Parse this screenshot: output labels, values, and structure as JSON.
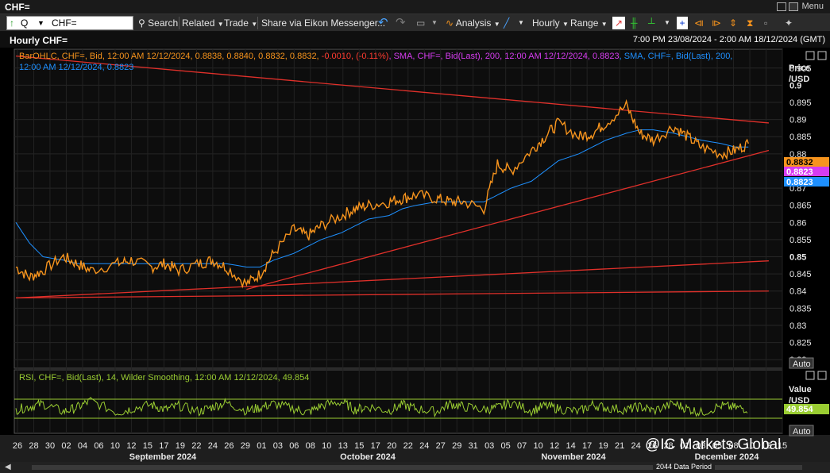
{
  "window": {
    "title": "CHF=",
    "menu_label": "Menu"
  },
  "toolbar": {
    "ric_value": "CHF=",
    "search_label": "Search",
    "related_label": "Related",
    "trade_label": "Trade",
    "share_label": "Share via Eikon Messenger...",
    "analysis_label": "Analysis",
    "interval_label": "Hourly",
    "range_label": "Range"
  },
  "chart_header": {
    "title": "Hourly CHF=",
    "range": "7:00 PM 23/08/2024 - 2:00 AM 18/12/2024 (GMT)"
  },
  "legend": {
    "l1_a": "BarOHLC, CHF=, Bid, 12:00 AM 12/12/2024, 0.8838, 0.8840, 0.8832, 0.8832, ",
    "l1_b": "-0.0010, (-0.11%)",
    "l1_c": ", SMA, CHF=, Bid(Last), 200, 12:00 AM 12/12/2024, 0.8823",
    "l1_d": ", SMA, CHF=, Bid(Last), 200,",
    "l2": "12:00 AM 12/12/2024, 0.8823"
  },
  "price_axis": {
    "title_1": "Price",
    "title_2": "/USD",
    "ticks": [
      "0.905",
      "0.9",
      "0.895",
      "0.89",
      "0.885",
      "0.88",
      "0.875",
      "0.87",
      "0.865",
      "0.86",
      "0.855",
      "0.85",
      "0.845",
      "0.84",
      "0.835",
      "0.83",
      "0.825",
      "0.82"
    ],
    "tags": [
      {
        "label": "0.8832",
        "value": 0.8832,
        "bg": "#f7941d",
        "fg": "#000000"
      },
      {
        "label": "0.8823",
        "value": 0.8823,
        "bg": "#d63cf0",
        "fg": "#ffffff"
      },
      {
        "label": "0.8823",
        "value": 0.8823,
        "bg": "#1e90ff",
        "fg": "#ffffff"
      }
    ],
    "auto_label": "Auto"
  },
  "rsi": {
    "legend": "RSI, CHF=, Bid(Last), 14, Wilder Smoothing, 12:00 AM 12/12/2024, 49.854",
    "axis_title_1": "Value",
    "axis_title_2": "/USD",
    "tag": "49.854",
    "auto_label": "Auto"
  },
  "x_axis": {
    "days": [
      "26",
      "28",
      "30",
      "02",
      "04",
      "06",
      "10",
      "12",
      "15",
      "17",
      "19",
      "22",
      "24",
      "26",
      "29",
      "01",
      "03",
      "06",
      "08",
      "10",
      "13",
      "15",
      "17",
      "20",
      "22",
      "24",
      "27",
      "29",
      "31",
      "03",
      "05",
      "07",
      "10",
      "12",
      "14",
      "17",
      "19",
      "21",
      "24",
      "26",
      "28",
      "01",
      "03",
      "05",
      "08",
      "10",
      "12",
      "15"
    ],
    "months": [
      "September 2024",
      "October 2024",
      "November 2024",
      "December 2024"
    ]
  },
  "watermark": "@IC Markets Global",
  "footer": {
    "period": "2044 Data Period"
  },
  "colors": {
    "price": "#f7941d",
    "sma": "#1e90ff",
    "trend": "#e0302a",
    "rsi": "#9acd32",
    "grid": "#2e2e2e"
  },
  "chart_data": {
    "type": "line",
    "title": "Hourly CHF=",
    "ylabel": "Price /USD",
    "ylim": [
      0.8175,
      0.9105
    ],
    "x": [
      "2024-08-26",
      "2024-08-28",
      "2024-08-30",
      "2024-09-02",
      "2024-09-04",
      "2024-09-06",
      "2024-09-10",
      "2024-09-12",
      "2024-09-15",
      "2024-09-17",
      "2024-09-19",
      "2024-09-22",
      "2024-09-24",
      "2024-09-26",
      "2024-09-29",
      "2024-10-01",
      "2024-10-03",
      "2024-10-06",
      "2024-10-08",
      "2024-10-10",
      "2024-10-13",
      "2024-10-15",
      "2024-10-17",
      "2024-10-20",
      "2024-10-22",
      "2024-10-24",
      "2024-10-27",
      "2024-10-29",
      "2024-10-31",
      "2024-11-03",
      "2024-11-05",
      "2024-11-07",
      "2024-11-10",
      "2024-11-12",
      "2024-11-14",
      "2024-11-17",
      "2024-11-19",
      "2024-11-21",
      "2024-11-24",
      "2024-11-26",
      "2024-11-28",
      "2024-12-01",
      "2024-12-03",
      "2024-12-05",
      "2024-12-08",
      "2024-12-10",
      "2024-12-12"
    ],
    "series": [
      {
        "values": [
          0.847,
          0.844,
          0.846,
          0.85,
          0.848,
          0.846,
          0.848,
          0.849,
          0.847,
          0.848,
          0.846,
          0.848,
          0.849,
          0.847,
          0.842,
          0.845,
          0.851,
          0.858,
          0.856,
          0.859,
          0.862,
          0.864,
          0.865,
          0.866,
          0.867,
          0.868,
          0.867,
          0.866,
          0.866,
          0.864,
          0.877,
          0.875,
          0.881,
          0.885,
          0.889,
          0.885,
          0.886,
          0.889,
          0.894,
          0.886,
          0.884,
          0.888,
          0.885,
          0.882,
          0.88,
          0.881,
          0.883
        ]
      },
      {
        "values": [
          0.86,
          0.854,
          0.85,
          0.849,
          0.848,
          0.848,
          0.848,
          0.848,
          0.848,
          0.848,
          0.848,
          0.848,
          0.848,
          0.848,
          0.847,
          0.847,
          0.849,
          0.851,
          0.853,
          0.855,
          0.857,
          0.859,
          0.861,
          0.862,
          0.864,
          0.865,
          0.866,
          0.866,
          0.866,
          0.866,
          0.868,
          0.87,
          0.872,
          0.875,
          0.878,
          0.88,
          0.882,
          0.884,
          0.886,
          0.887,
          0.887,
          0.886,
          0.885,
          0.884,
          0.883,
          0.882,
          0.882
        ]
      }
    ],
    "trendlines": [
      {
        "from": [
          "2024-08-26",
          0.9085
        ],
        "to": [
          "2024-12-15",
          0.889
        ]
      },
      {
        "from": [
          "2024-09-29",
          0.8405
        ],
        "to": [
          "2024-12-15",
          0.881
        ]
      },
      {
        "from": [
          "2024-08-26",
          0.838
        ],
        "to": [
          "2024-12-15",
          0.8488
        ]
      },
      {
        "from": [
          "2024-08-26",
          0.838
        ],
        "to": [
          "2024-12-15",
          0.84
        ]
      }
    ],
    "rsi_series": [
      49,
      52,
      55,
      47,
      51,
      58,
      46,
      50,
      54,
      49,
      53,
      47,
      52,
      56,
      48,
      51,
      55,
      50,
      46,
      53,
      57,
      49,
      52,
      48,
      54,
      50,
      47,
      55,
      52,
      49,
      51,
      56,
      48,
      53,
      50,
      47,
      54,
      51,
      49,
      52,
      48,
      55,
      50,
      46,
      53,
      51,
      50
    ]
  }
}
